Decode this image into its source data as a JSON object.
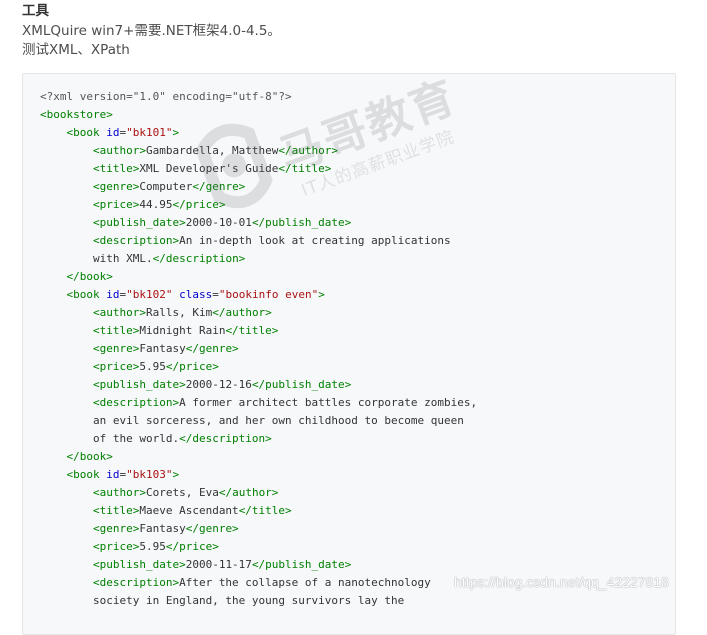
{
  "intro": {
    "heading": "工具",
    "tool_line": "XMLQuire win7+需要.NET框架4.0-4.5。",
    "test_line": "测试XML、XPath"
  },
  "code": {
    "lines": [
      [
        {
          "t": "pi",
          "s": "<?xml version=\"1.0\" encoding=\"utf-8\"?>"
        }
      ],
      [
        {
          "t": "tag",
          "s": "<bookstore>"
        }
      ],
      [
        {
          "t": "txt",
          "s": "    "
        },
        {
          "t": "tag",
          "s": "<book "
        },
        {
          "t": "attr",
          "s": "id"
        },
        {
          "t": "txt",
          "s": "="
        },
        {
          "t": "val",
          "s": "\"bk101\""
        },
        {
          "t": "tag",
          "s": ">"
        }
      ],
      [
        {
          "t": "txt",
          "s": "        "
        },
        {
          "t": "tag",
          "s": "<author>"
        },
        {
          "t": "txt",
          "s": "Gambardella, Matthew"
        },
        {
          "t": "tag",
          "s": "</author>"
        }
      ],
      [
        {
          "t": "txt",
          "s": "        "
        },
        {
          "t": "tag",
          "s": "<title>"
        },
        {
          "t": "txt",
          "s": "XML Developer's Guide"
        },
        {
          "t": "tag",
          "s": "</title>"
        }
      ],
      [
        {
          "t": "txt",
          "s": "        "
        },
        {
          "t": "tag",
          "s": "<genre>"
        },
        {
          "t": "txt",
          "s": "Computer"
        },
        {
          "t": "tag",
          "s": "</genre>"
        }
      ],
      [
        {
          "t": "txt",
          "s": "        "
        },
        {
          "t": "tag",
          "s": "<price>"
        },
        {
          "t": "txt",
          "s": "44.95"
        },
        {
          "t": "tag",
          "s": "</price>"
        }
      ],
      [
        {
          "t": "txt",
          "s": "        "
        },
        {
          "t": "tag",
          "s": "<publish_date>"
        },
        {
          "t": "txt",
          "s": "2000-10-01"
        },
        {
          "t": "tag",
          "s": "</publish_date>"
        }
      ],
      [
        {
          "t": "txt",
          "s": "        "
        },
        {
          "t": "tag",
          "s": "<description>"
        },
        {
          "t": "txt",
          "s": "An in-depth look at creating applications"
        }
      ],
      [
        {
          "t": "txt",
          "s": "        with XML."
        },
        {
          "t": "tag",
          "s": "</description>"
        }
      ],
      [
        {
          "t": "txt",
          "s": "    "
        },
        {
          "t": "tag",
          "s": "</book>"
        }
      ],
      [
        {
          "t": "txt",
          "s": "    "
        },
        {
          "t": "tag",
          "s": "<book "
        },
        {
          "t": "attr",
          "s": "id"
        },
        {
          "t": "txt",
          "s": "="
        },
        {
          "t": "val",
          "s": "\"bk102\""
        },
        {
          "t": "txt",
          "s": " "
        },
        {
          "t": "attr",
          "s": "class"
        },
        {
          "t": "txt",
          "s": "="
        },
        {
          "t": "val",
          "s": "\"bookinfo even\""
        },
        {
          "t": "tag",
          "s": ">"
        }
      ],
      [
        {
          "t": "txt",
          "s": "        "
        },
        {
          "t": "tag",
          "s": "<author>"
        },
        {
          "t": "txt",
          "s": "Ralls, Kim"
        },
        {
          "t": "tag",
          "s": "</author>"
        }
      ],
      [
        {
          "t": "txt",
          "s": "        "
        },
        {
          "t": "tag",
          "s": "<title>"
        },
        {
          "t": "txt",
          "s": "Midnight Rain"
        },
        {
          "t": "tag",
          "s": "</title>"
        }
      ],
      [
        {
          "t": "txt",
          "s": "        "
        },
        {
          "t": "tag",
          "s": "<genre>"
        },
        {
          "t": "txt",
          "s": "Fantasy"
        },
        {
          "t": "tag",
          "s": "</genre>"
        }
      ],
      [
        {
          "t": "txt",
          "s": "        "
        },
        {
          "t": "tag",
          "s": "<price>"
        },
        {
          "t": "txt",
          "s": "5.95"
        },
        {
          "t": "tag",
          "s": "</price>"
        }
      ],
      [
        {
          "t": "txt",
          "s": "        "
        },
        {
          "t": "tag",
          "s": "<publish_date>"
        },
        {
          "t": "txt",
          "s": "2000-12-16"
        },
        {
          "t": "tag",
          "s": "</publish_date>"
        }
      ],
      [
        {
          "t": "txt",
          "s": "        "
        },
        {
          "t": "tag",
          "s": "<description>"
        },
        {
          "t": "txt",
          "s": "A former architect battles corporate zombies,"
        }
      ],
      [
        {
          "t": "txt",
          "s": "        an evil sorceress, and her own childhood to become queen"
        }
      ],
      [
        {
          "t": "txt",
          "s": "        of the world."
        },
        {
          "t": "tag",
          "s": "</description>"
        }
      ],
      [
        {
          "t": "txt",
          "s": "    "
        },
        {
          "t": "tag",
          "s": "</book>"
        }
      ],
      [
        {
          "t": "txt",
          "s": "    "
        },
        {
          "t": "tag",
          "s": "<book "
        },
        {
          "t": "attr",
          "s": "id"
        },
        {
          "t": "txt",
          "s": "="
        },
        {
          "t": "val",
          "s": "\"bk103\""
        },
        {
          "t": "tag",
          "s": ">"
        }
      ],
      [
        {
          "t": "txt",
          "s": "        "
        },
        {
          "t": "tag",
          "s": "<author>"
        },
        {
          "t": "txt",
          "s": "Corets, Eva"
        },
        {
          "t": "tag",
          "s": "</author>"
        }
      ],
      [
        {
          "t": "txt",
          "s": "        "
        },
        {
          "t": "tag",
          "s": "<title>"
        },
        {
          "t": "txt",
          "s": "Maeve Ascendant"
        },
        {
          "t": "tag",
          "s": "</title>"
        }
      ],
      [
        {
          "t": "txt",
          "s": "        "
        },
        {
          "t": "tag",
          "s": "<genre>"
        },
        {
          "t": "txt",
          "s": "Fantasy"
        },
        {
          "t": "tag",
          "s": "</genre>"
        }
      ],
      [
        {
          "t": "txt",
          "s": "        "
        },
        {
          "t": "tag",
          "s": "<price>"
        },
        {
          "t": "txt",
          "s": "5.95"
        },
        {
          "t": "tag",
          "s": "</price>"
        }
      ],
      [
        {
          "t": "txt",
          "s": "        "
        },
        {
          "t": "tag",
          "s": "<publish_date>"
        },
        {
          "t": "txt",
          "s": "2000-11-17"
        },
        {
          "t": "tag",
          "s": "</publish_date>"
        }
      ],
      [
        {
          "t": "txt",
          "s": "        "
        },
        {
          "t": "tag",
          "s": "<description>"
        },
        {
          "t": "txt",
          "s": "After the collapse of a nanotechnology"
        }
      ],
      [
        {
          "t": "txt",
          "s": "        society in England, the young survivors lay the"
        }
      ]
    ]
  },
  "watermarks": {
    "brand": "马哥教育",
    "slogan": "IT人的高薪职业学院",
    "csdn": "https://blog.csdn.net/qq_42227818"
  },
  "colors": {
    "tag": "#008000",
    "attr": "#0000cc",
    "value": "#aa1111",
    "code_bg": "#f6f8fa"
  }
}
